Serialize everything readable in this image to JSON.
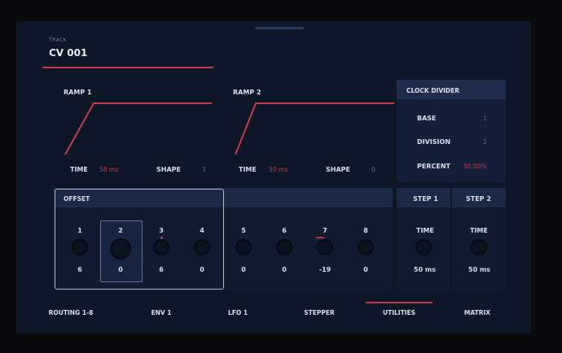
{
  "track": {
    "label": "TRACK",
    "name": "CV 001"
  },
  "ramp1": {
    "title": "RAMP 1",
    "time_label": "TIME",
    "time_value": "58 ms",
    "shape_label": "SHAPE",
    "shape_value": "3"
  },
  "ramp2": {
    "title": "RAMP 2",
    "time_label": "TIME",
    "time_value": "50 ms",
    "shape_label": "SHAPE",
    "shape_value": "0"
  },
  "clock": {
    "title": "CLOCK DIVIDER",
    "base_label": "BASE",
    "base_value": "1",
    "division_label": "DIVISION",
    "division_value": "1",
    "percent_label": "PERCENT",
    "percent_value": "50.00%"
  },
  "offset": {
    "title": "OFFSET",
    "columns": [
      {
        "num": "1",
        "value": "6"
      },
      {
        "num": "2",
        "value": "0"
      },
      {
        "num": "3",
        "value": "6"
      },
      {
        "num": "4",
        "value": "0"
      },
      {
        "num": "5",
        "value": "0"
      },
      {
        "num": "6",
        "value": "0"
      },
      {
        "num": "7",
        "value": "-19"
      },
      {
        "num": "8",
        "value": "0"
      }
    ]
  },
  "steps": [
    {
      "title": "STEP 1",
      "time_label": "TIME",
      "time_value": "50 ms"
    },
    {
      "title": "STEP 2",
      "time_label": "TIME",
      "time_value": "50 ms"
    }
  ],
  "tabs": [
    "ROUTING 1-8",
    "ENV 1",
    "LFO 1",
    "STEPPER",
    "UTILITIES",
    "MATRIX"
  ],
  "active_tab": "UTILITIES",
  "colors": {
    "accent": "#c8384d",
    "background": "#0e1728",
    "header": "#1a2944"
  }
}
